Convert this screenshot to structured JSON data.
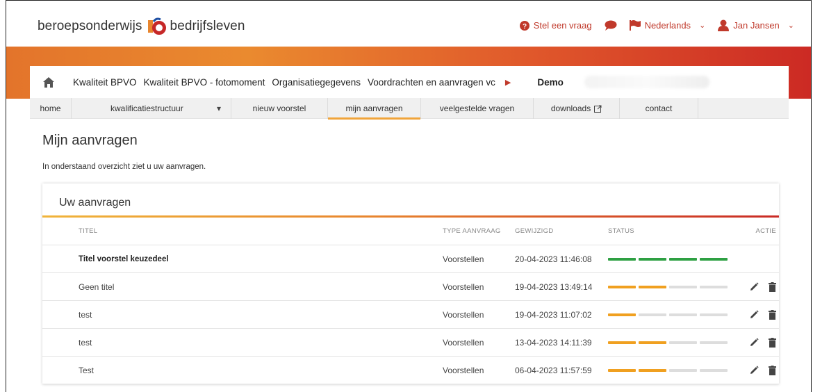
{
  "header": {
    "logo_left": "beroepsonderwijs",
    "logo_right": "bedrijfsleven",
    "help_label": "Stel een vraag",
    "language_label": "Nederlands",
    "user_name": "Jan Jansen"
  },
  "breadcrumb": {
    "items": [
      "Kwaliteit BPVO",
      "Kwaliteit BPVO - fotomoment",
      "Organisatiegegevens",
      "Voordrachten en aanvragen vc"
    ],
    "current": "Demo"
  },
  "nav": {
    "tabs": [
      {
        "label": "home",
        "width": 60
      },
      {
        "label": "kwalificatiestructuur",
        "width": 230
      },
      {
        "label": "nieuw voorstel",
        "width": 139
      },
      {
        "label": "mijn aanvragen",
        "width": 134
      },
      {
        "label": "veelgestelde vragen",
        "width": 162
      },
      {
        "label": "downloads",
        "width": 124
      },
      {
        "label": "contact",
        "width": 113
      }
    ],
    "active_index": 3
  },
  "page": {
    "title": "Mijn aanvragen",
    "intro": "In onderstaand overzicht ziet u uw aanvragen."
  },
  "table": {
    "card_title": "Uw aanvragen",
    "columns": {
      "title": "TITEL",
      "type": "TYPE AANVRAAG",
      "modified": "GEWIJZIGD",
      "status": "STATUS",
      "action": "ACTIE"
    },
    "rows": [
      {
        "title": "Titel voorstel keuzedeel",
        "type": "Voorstellen",
        "modified": "20-04-2023 11:46:08",
        "status_steps_complete": 4,
        "status_color": "#2ea043",
        "editable": false
      },
      {
        "title": "Geen titel",
        "type": "Voorstellen",
        "modified": "19-04-2023 13:49:14",
        "status_steps_complete": 2,
        "status_color": "#f0a020",
        "editable": true
      },
      {
        "title": "test",
        "type": "Voorstellen",
        "modified": "19-04-2023 11:07:02",
        "status_steps_complete": 1,
        "status_color": "#f0a020",
        "editable": true
      },
      {
        "title": "test",
        "type": "Voorstellen",
        "modified": "13-04-2023 14:11:39",
        "status_steps_complete": 2,
        "status_color": "#f0a020",
        "editable": true
      },
      {
        "title": "Test",
        "type": "Voorstellen",
        "modified": "06-04-2023 11:57:59",
        "status_steps_complete": 2,
        "status_color": "#f0a020",
        "editable": true
      }
    ],
    "status_steps_total": 4
  },
  "colors": {
    "accent_red": "#c0392b",
    "accent_orange": "#f0a43a",
    "status_empty": "#dddddd"
  }
}
